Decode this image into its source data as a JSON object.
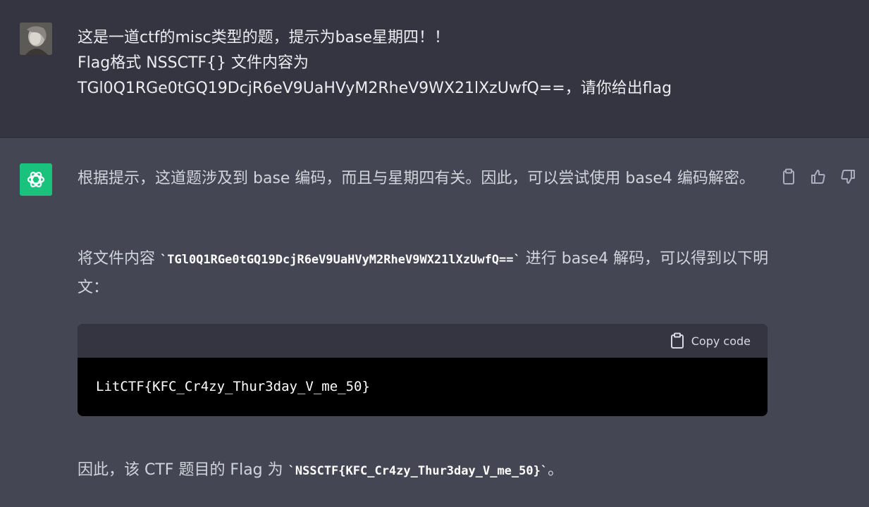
{
  "user_message": {
    "lines": [
      "这是一道ctf的misc类型的题，提示为base星期四！！",
      "Flag格式 NSSCTF{}  文件内容为",
      "TGl0Q1RGe0tGQ19DcjR6eV9UaHVyM2RheV9WX21lXzUwfQ==，请你给出flag"
    ]
  },
  "assistant_message": {
    "p1": "根据提示，这道题涉及到 base 编码，而且与星期四有关。因此，可以尝试使用 base4 编码解密。",
    "p2_before": "将文件内容 ",
    "p2_code": "`TGl0Q1RGe0tGQ19DcjR6eV9UaHVyM2RheV9WX21lXzUwfQ==`",
    "p2_after": " 进行 base4 解码，可以得到以下明文：",
    "code_block": {
      "copy_label": "Copy code",
      "content": "LitCTF{KFC_Cr4zy_Thur3day_V_me_50}"
    },
    "p3_before": "因此，该 CTF 题目的 Flag 为 ",
    "p3_code": "`NSSCTF{KFC_Cr4zy_Thur3day_V_me_50}`",
    "p3_after": "。"
  },
  "icons": {
    "user_avatar": "user-avatar-photo",
    "assistant_avatar": "openai-logo-icon",
    "copy": "clipboard-icon",
    "like": "thumbs-up-icon",
    "dislike": "thumbs-down-icon"
  },
  "colors": {
    "user_bg": "#343541",
    "assistant_bg": "#444654",
    "accent": "#19c37d",
    "code_bg": "#000000"
  }
}
